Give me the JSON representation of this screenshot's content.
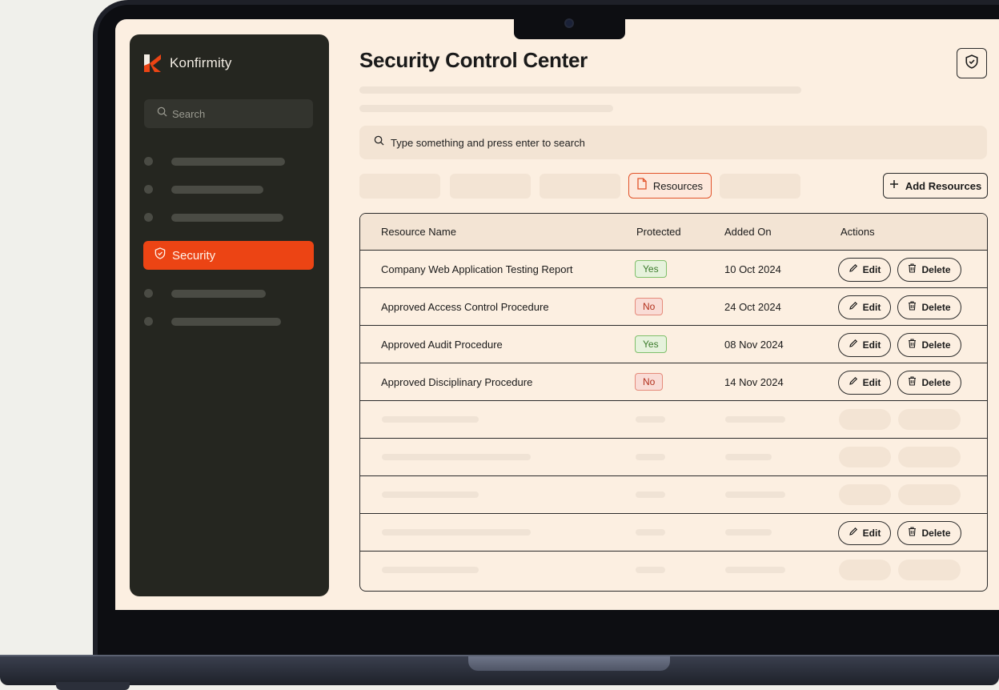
{
  "app": {
    "brand": "Konfirmity"
  },
  "sidebar": {
    "search_placeholder": "Search",
    "active_item": {
      "label": "Security",
      "icon": "shield-check-icon"
    }
  },
  "header": {
    "title": "Security Control Center",
    "action_icon": "shield-check-icon"
  },
  "search": {
    "placeholder": "Type something and press enter to search"
  },
  "tabs": {
    "active_label": "Resources",
    "active_icon": "file-icon"
  },
  "toolbar": {
    "add_label": "Add Resources",
    "add_icon": "plus-icon"
  },
  "table": {
    "columns": [
      "Resource Name",
      "Protected",
      "Added On",
      "Actions"
    ],
    "rows": [
      {
        "name": "Company Web Application Testing Report",
        "protected": "Yes",
        "added_on": "10 Oct 2024"
      },
      {
        "name": "Approved Access Control Procedure",
        "protected": "No",
        "added_on": "24 Oct 2024"
      },
      {
        "name": "Approved Audit Procedure",
        "protected": "Yes",
        "added_on": "08 Nov 2024"
      },
      {
        "name": "Approved Disciplinary Procedure",
        "protected": "No",
        "added_on": "14 Nov 2024"
      }
    ],
    "edit_label": "Edit",
    "delete_label": "Delete"
  },
  "colors": {
    "accent": "#ec4414",
    "sidebar_bg": "#252620",
    "page_bg": "#fcefe1",
    "yes": "#3a7a2a",
    "no": "#b2301d"
  }
}
